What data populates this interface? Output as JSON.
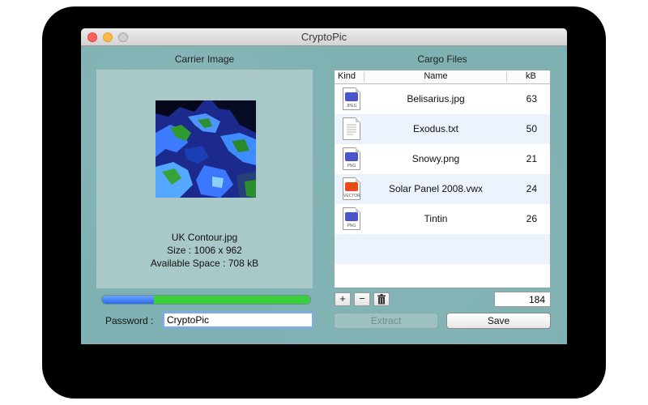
{
  "window": {
    "title": "CryptoPic"
  },
  "carrier": {
    "heading": "Carrier Image",
    "file_name": "UK Contour.jpg",
    "size_line": "Size :  1006 x 962",
    "space_line": "Available Space : 708 kB",
    "capacity_used_fraction": 0.25
  },
  "password": {
    "label": "Password :",
    "value": "CryptoPic"
  },
  "cargo": {
    "heading": "Cargo Files",
    "columns": {
      "kind": "Kind",
      "name": "Name",
      "size": "kB"
    },
    "files": [
      {
        "name": "Belisarius.jpg",
        "size": "63",
        "icon": "jpeg-file-icon",
        "type": "JPEG",
        "color": "#4a55c8"
      },
      {
        "name": "Exodus.txt",
        "size": "50",
        "icon": "text-file-icon",
        "type": "",
        "color": ""
      },
      {
        "name": "Snowy.png",
        "size": "21",
        "icon": "png-file-icon",
        "type": "PNG",
        "color": "#4a55c8"
      },
      {
        "name": "Solar Panel 2008.vwx",
        "size": "24",
        "icon": "vwx-file-icon",
        "type": "VECTOR",
        "color": "#e84a1a"
      },
      {
        "name": "Tintin",
        "size": "26",
        "icon": "png-file-icon",
        "type": "PNG",
        "color": "#4a55c8"
      }
    ],
    "total": "184",
    "add_label": "+",
    "remove_label": "−",
    "trash_icon": "trash-icon"
  },
  "buttons": {
    "extract": "Extract",
    "save": "Save"
  },
  "colors": {
    "window_bg": "#7fb1b2",
    "panel_bg": "#a8c9c7",
    "progress_used": "#2a6cf0",
    "progress_free": "#39d139",
    "row_alt": "#edf3fd"
  }
}
